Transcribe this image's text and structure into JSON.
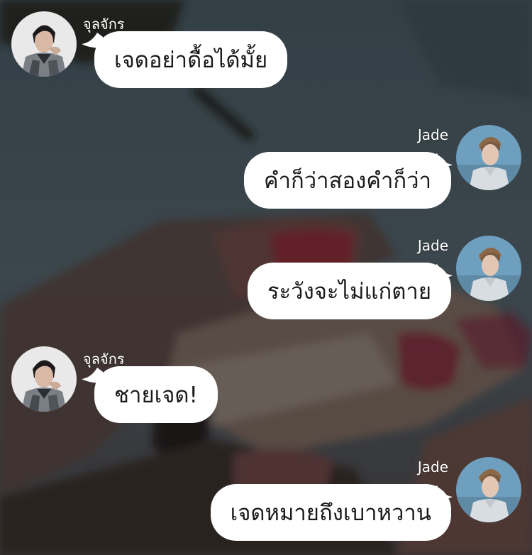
{
  "conversation": {
    "messages": [
      {
        "side": "left",
        "sender": "จุลจักร",
        "text": "เจดอย่าดื้อได้มั้ย"
      },
      {
        "side": "right",
        "sender": "Jade",
        "text": "คำก็ว่าสองคำก็ว่า"
      },
      {
        "side": "right",
        "sender": "Jade",
        "text": "ระวังจะไม่แก่ตาย"
      },
      {
        "side": "left",
        "sender": "จุลจักร",
        "text": "ชายเจด!"
      },
      {
        "side": "right",
        "sender": "Jade",
        "text": "เจดหมายถึงเบาหวาน"
      }
    ]
  },
  "colors": {
    "bubble": "#ffffff",
    "name_text": "#ffffff",
    "message_text": "#1a1a1a",
    "background_tint": "#3b4a52"
  }
}
